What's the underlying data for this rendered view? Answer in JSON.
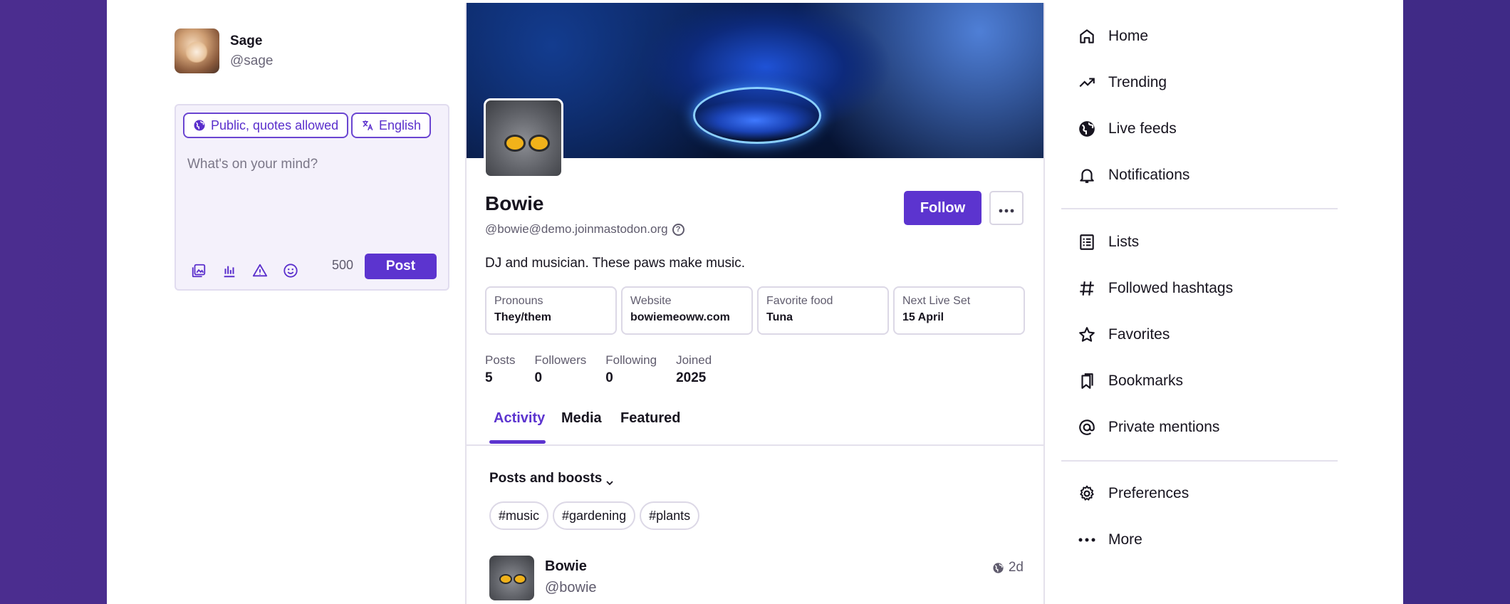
{
  "account": {
    "name": "Sage",
    "handle": "@sage"
  },
  "composer": {
    "visibility_label": "Public, quotes allowed",
    "language_label": "English",
    "placeholder": "What's on your mind?",
    "char_count": "500",
    "post_label": "Post"
  },
  "profile": {
    "display_name": "Bowie",
    "acct": "@bowie@demo.joinmastodon.org",
    "follow_label": "Follow",
    "bio": "DJ and musician. These paws make music.",
    "fields": [
      {
        "name": "Pronouns",
        "value": "They/them"
      },
      {
        "name": "Website",
        "value": "bowiemeoww.com"
      },
      {
        "name": "Favorite food",
        "value": "Tuna"
      },
      {
        "name": "Next Live Set",
        "value": "15 April"
      }
    ],
    "stats": [
      {
        "label": "Posts",
        "value": "5"
      },
      {
        "label": "Followers",
        "value": "0"
      },
      {
        "label": "Following",
        "value": "0"
      },
      {
        "label": "Joined",
        "value": "2025"
      }
    ],
    "tabs": [
      {
        "label": "Activity",
        "active": true
      },
      {
        "label": "Media",
        "active": false
      },
      {
        "label": "Featured",
        "active": false
      }
    ],
    "filter_label": "Posts and boosts",
    "hashtags": [
      "#music",
      "#gardening",
      "#plants"
    ],
    "status": {
      "name": "Bowie",
      "handle": "@bowie",
      "time": "2d"
    }
  },
  "nav": {
    "items": [
      {
        "label": "Home",
        "icon": "home-icon"
      },
      {
        "label": "Trending",
        "icon": "trending-icon"
      },
      {
        "label": "Live feeds",
        "icon": "globe-icon"
      },
      {
        "label": "Notifications",
        "icon": "bell-icon"
      },
      {
        "label": "Lists",
        "icon": "list-icon"
      },
      {
        "label": "Followed hashtags",
        "icon": "hashtag-icon"
      },
      {
        "label": "Favorites",
        "icon": "star-icon"
      },
      {
        "label": "Bookmarks",
        "icon": "bookmark-icon"
      },
      {
        "label": "Private mentions",
        "icon": "at-icon"
      },
      {
        "label": "Preferences",
        "icon": "gear-icon"
      },
      {
        "label": "More",
        "icon": "ellipsis-icon"
      }
    ]
  },
  "colors": {
    "accent": "#5c34cf",
    "page_background": "#4b2d8f"
  }
}
